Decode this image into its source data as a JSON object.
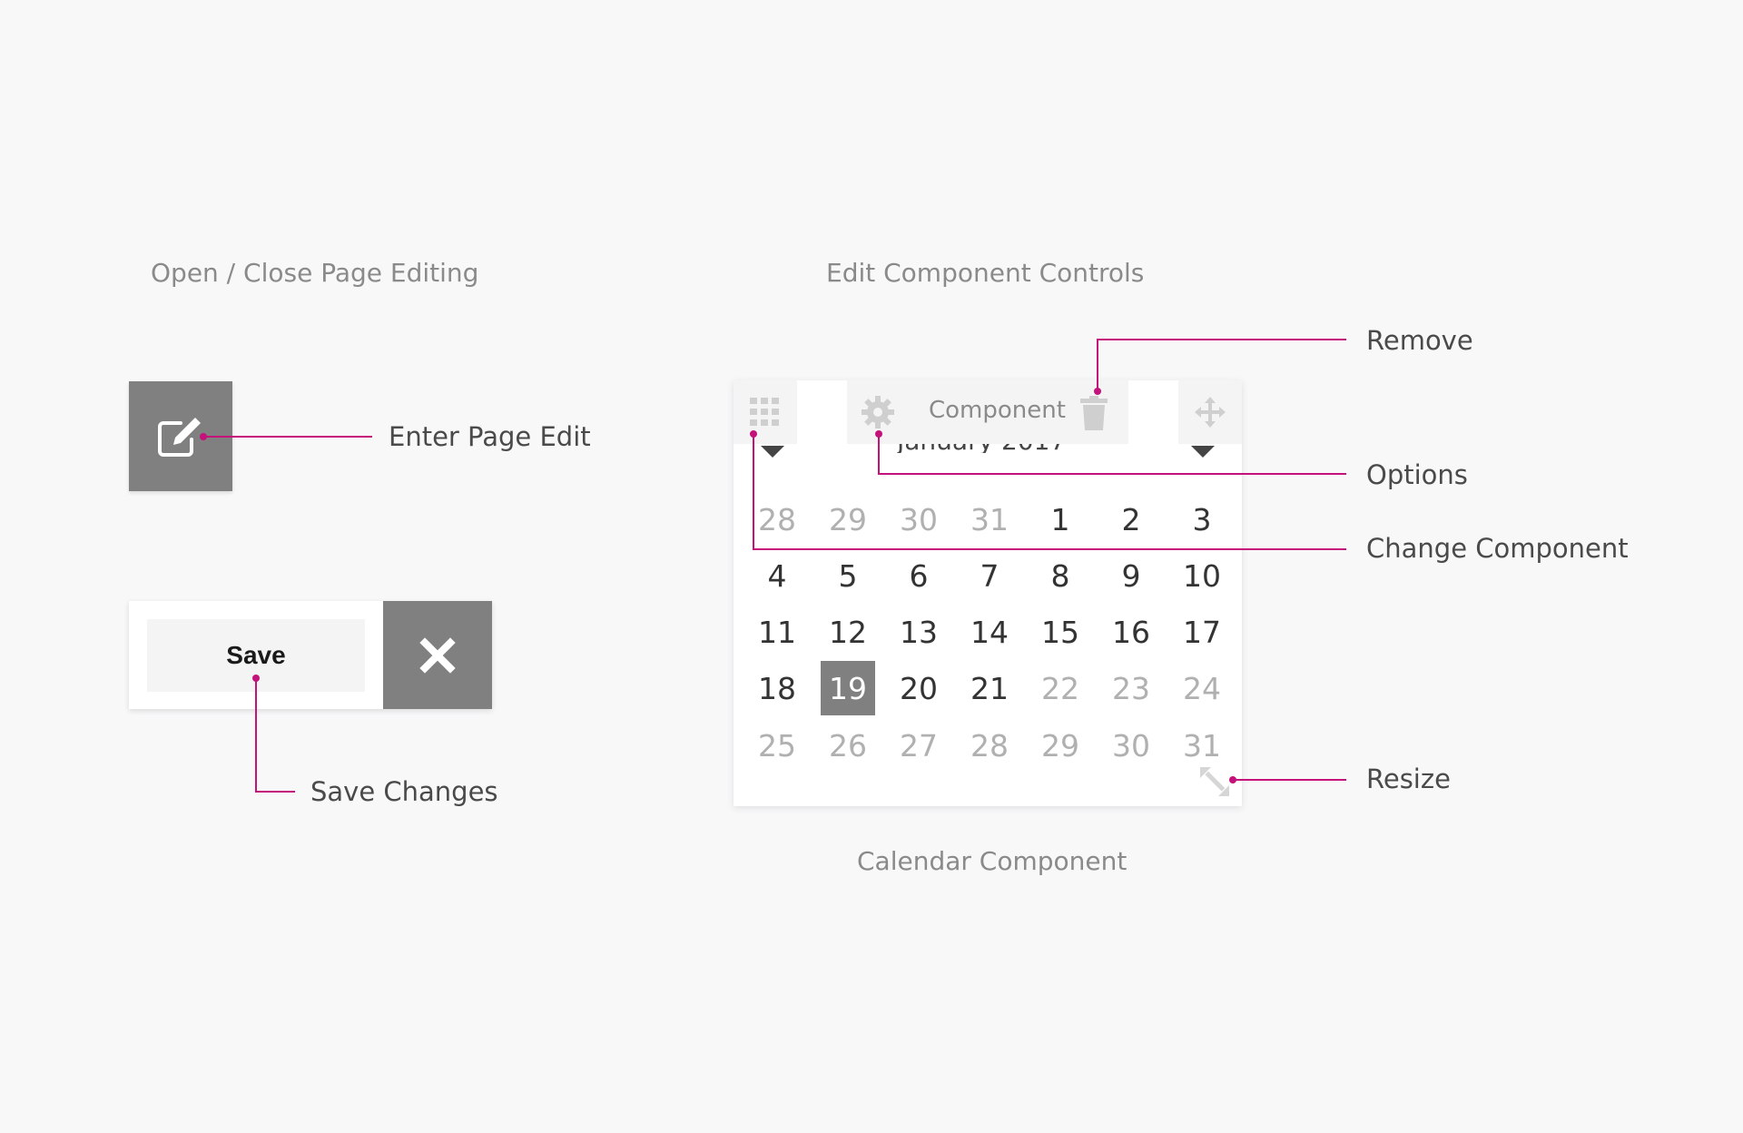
{
  "titles": {
    "left": "Open / Close Page Editing",
    "right": "Edit Component Controls",
    "caption": "Calendar Component"
  },
  "callouts": {
    "enter_edit": "Enter Page Edit",
    "save_changes": "Save Changes",
    "remove": "Remove",
    "options": "Options",
    "change_component": "Change Component",
    "resize": "Resize"
  },
  "save_bar": {
    "save_label": "Save"
  },
  "component_toolbar": {
    "label": "Component"
  },
  "calendar": {
    "month_label": "January 2017",
    "weeks": [
      [
        {
          "d": "28",
          "m": true
        },
        {
          "d": "29",
          "m": true
        },
        {
          "d": "30",
          "m": true
        },
        {
          "d": "31",
          "m": true
        },
        {
          "d": "1"
        },
        {
          "d": "2"
        },
        {
          "d": "3"
        }
      ],
      [
        {
          "d": "4"
        },
        {
          "d": "5"
        },
        {
          "d": "6"
        },
        {
          "d": "7"
        },
        {
          "d": "8"
        },
        {
          "d": "9"
        },
        {
          "d": "10"
        }
      ],
      [
        {
          "d": "11"
        },
        {
          "d": "12"
        },
        {
          "d": "13"
        },
        {
          "d": "14"
        },
        {
          "d": "15"
        },
        {
          "d": "16"
        },
        {
          "d": "17"
        }
      ],
      [
        {
          "d": "18"
        },
        {
          "d": "19",
          "s": true
        },
        {
          "d": "20"
        },
        {
          "d": "21"
        },
        {
          "d": "22",
          "m": true
        },
        {
          "d": "23",
          "m": true
        },
        {
          "d": "24",
          "m": true
        }
      ],
      [
        {
          "d": "25",
          "m": true
        },
        {
          "d": "26",
          "m": true
        },
        {
          "d": "27",
          "m": true
        },
        {
          "d": "28",
          "m": true
        },
        {
          "d": "29",
          "m": true
        },
        {
          "d": "30",
          "m": true
        },
        {
          "d": "31",
          "m": true
        }
      ]
    ]
  },
  "colors": {
    "accent": "#c4127a",
    "button_gray": "#808080",
    "background": "#f8f8f9"
  }
}
